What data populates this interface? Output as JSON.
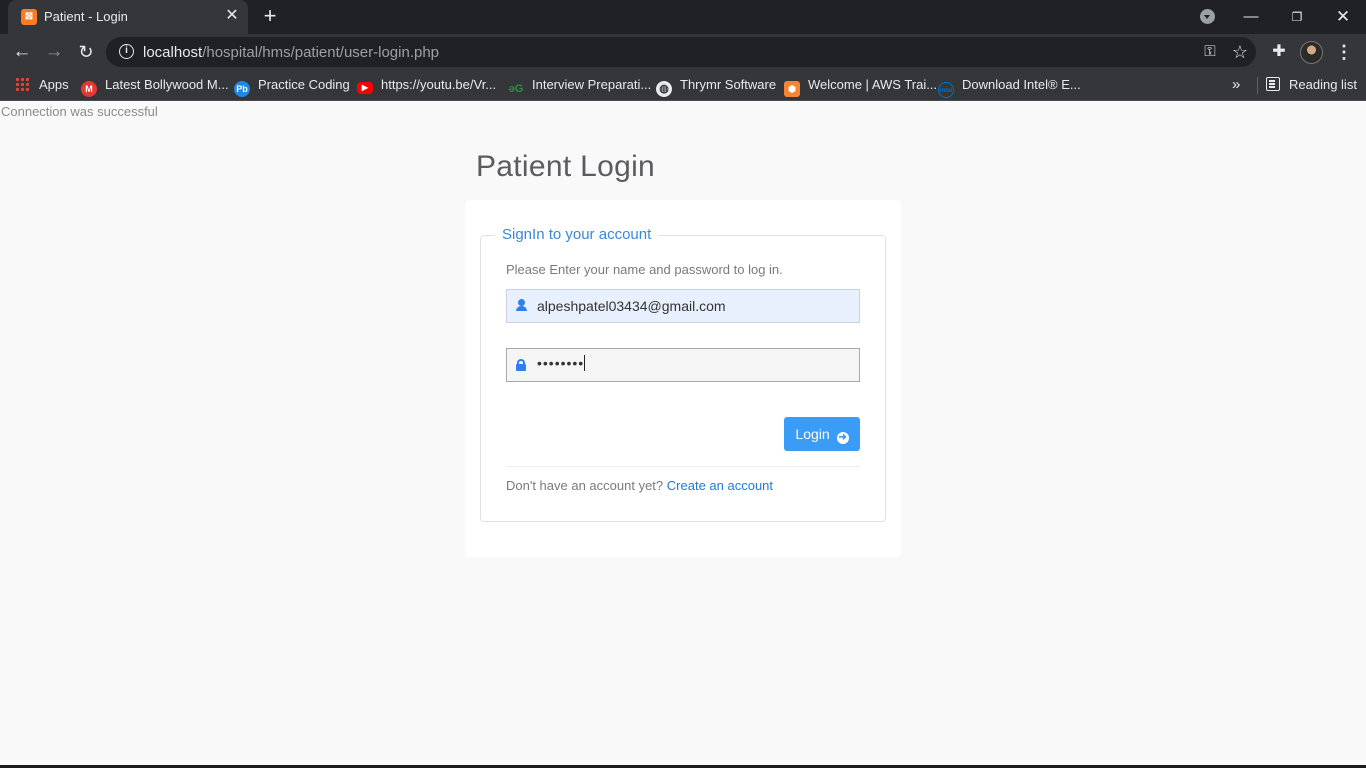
{
  "browser": {
    "tab": {
      "title": "Patient - Login",
      "favicon": "xampp-icon",
      "close": "✕"
    },
    "new_tab": "+",
    "window_controls": {
      "minimize": "—",
      "maximize": "❐",
      "close": "✕"
    },
    "nav": {
      "back": "←",
      "forward": "→",
      "reload": "↻"
    },
    "address": {
      "host": "localhost",
      "path": "/hospital/hms/patient/user-login.php"
    },
    "bookmarks": [
      {
        "label": "Apps",
        "icon": "apps-grid-icon"
      },
      {
        "label": "Latest Bollywood M...",
        "icon": "m-red-icon",
        "color": "#e53935"
      },
      {
        "label": "Practice Coding",
        "icon": "pb-icon",
        "color": "#1e88e5"
      },
      {
        "label": "https://youtu.be/Vr...",
        "icon": "youtube-icon",
        "color": "#ff0000"
      },
      {
        "label": "Interview Preparati...",
        "icon": "gfg-icon",
        "color": "#2f8d46"
      },
      {
        "label": "Thrymr Software",
        "icon": "globe-icon",
        "color": "#e8eaed"
      },
      {
        "label": "Welcome | AWS Trai...",
        "icon": "aws-icon",
        "color": "#f58536"
      },
      {
        "label": "Download Intel® E...",
        "icon": "intel-icon",
        "color": "#0071c5"
      }
    ],
    "bookmarks_more": "»",
    "reading_list": "Reading list"
  },
  "page": {
    "connection_message": "Connection was successful",
    "title": "Patient Login",
    "form": {
      "legend": "SignIn to your account",
      "instructions": "Please Enter your name and password to log in.",
      "email_value": "alpeshpatel03434@gmail.com",
      "password_mask": "••••••••",
      "login_label": "Login",
      "signup_prompt": "Don't have an account yet?",
      "signup_link": "Create an account"
    }
  },
  "colors": {
    "accent": "#3b9cf7",
    "link": "#1f7ad3",
    "chrome_dark": "#202124",
    "chrome_toolbar": "#35363a"
  }
}
